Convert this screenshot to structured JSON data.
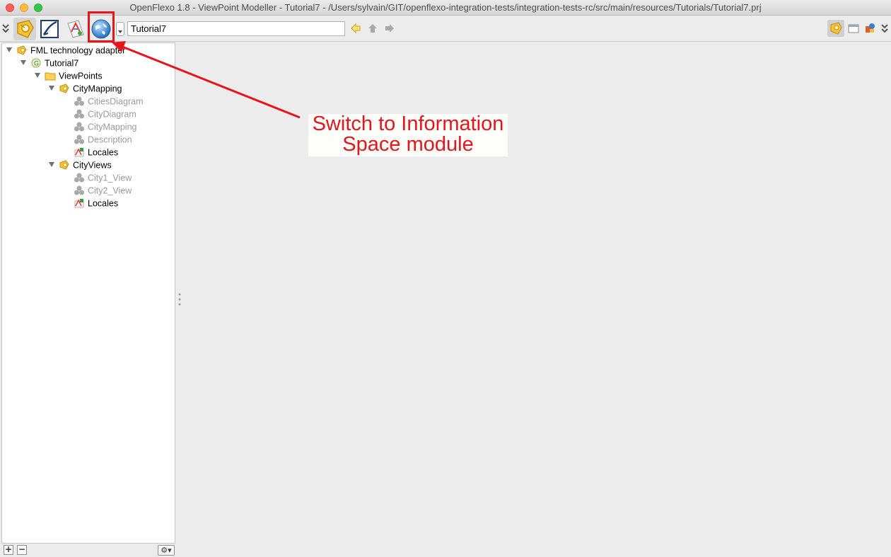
{
  "window": {
    "title": "OpenFlexo 1.8 - ViewPoint Modeller - Tutorial7 - /Users/sylvain/GIT/openflexo-integration-tests/integration-tests-rc/src/main/resources/Tutorials/Tutorial7.prj"
  },
  "toolbar": {
    "modules": [
      {
        "icon": "viewpoint-modeller-icon",
        "selected": true
      },
      {
        "icon": "diagram-module-icon",
        "selected": false
      },
      {
        "icon": "document-module-icon",
        "selected": false
      },
      {
        "icon": "information-space-globe-icon",
        "selected": false
      }
    ],
    "path_value": "Tutorial7",
    "accent_color": "#e5161b"
  },
  "tree": {
    "root": "FML technology adapter",
    "project": "Tutorial7",
    "folder": "ViewPoints",
    "viewpoints": [
      {
        "label": "CityMapping",
        "children": [
          "CitiesDiagram",
          "CityDiagram",
          "CityMapping",
          "Description",
          "Locales"
        ]
      },
      {
        "label": "CityViews",
        "children": [
          "City1_View",
          "City2_View",
          "Locales"
        ]
      }
    ]
  },
  "callout": {
    "line1": "Switch to Information",
    "line2": "Space module"
  },
  "bottom": {
    "add": "+",
    "remove": "−",
    "gear": "⚙▾"
  }
}
